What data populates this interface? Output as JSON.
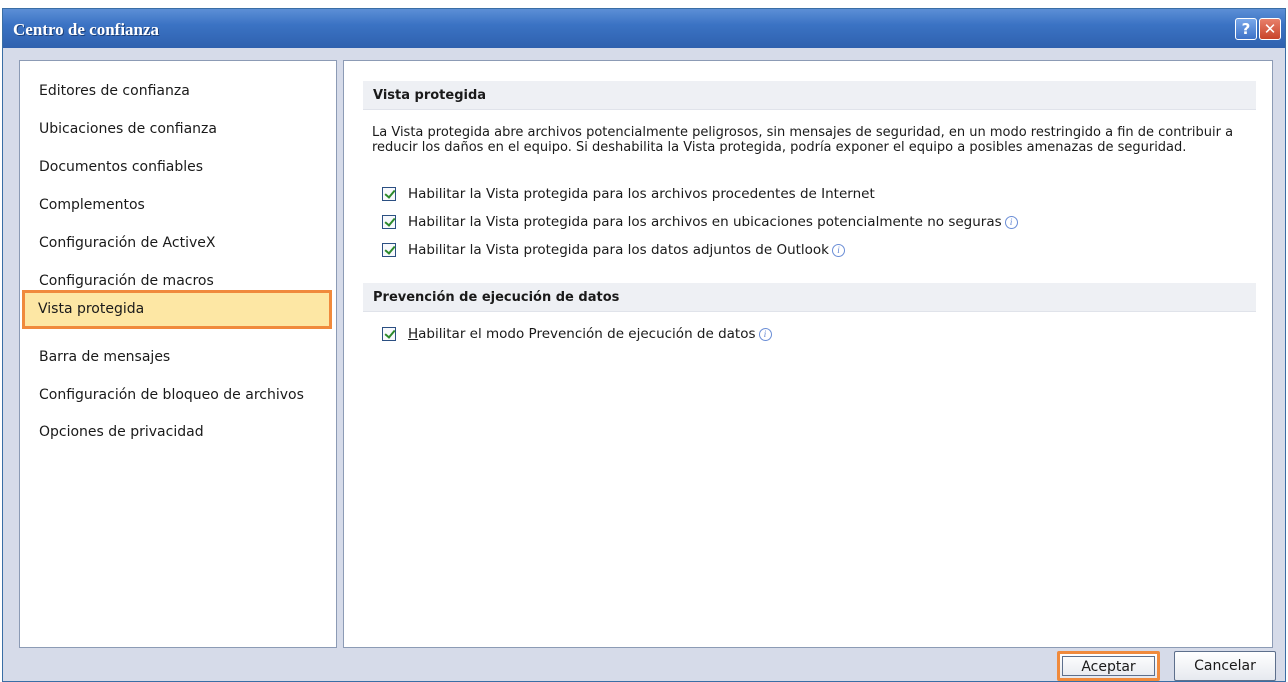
{
  "window": {
    "title": "Centro de confianza",
    "help_glyph": "?",
    "close_glyph": "✕"
  },
  "nav": {
    "items": [
      {
        "label": "Editores de confianza"
      },
      {
        "label": "Ubicaciones de confianza"
      },
      {
        "label": "Documentos confiables"
      },
      {
        "label": "Complementos"
      },
      {
        "label": "Configuración de ActiveX"
      },
      {
        "label": "Configuración de macros"
      },
      {
        "label": "Vista protegida",
        "selected": true
      },
      {
        "label": "Barra de mensajes"
      },
      {
        "label": "Configuración de bloqueo de archivos"
      },
      {
        "label": "Opciones de privacidad"
      }
    ]
  },
  "protected_view": {
    "header": "Vista protegida",
    "description": "La Vista protegida abre archivos potencialmente peligrosos, sin mensajes de seguridad, en un modo restringido a fin de contribuir a reducir los daños en el equipo. Si deshabilita la Vista protegida, podría exponer el equipo a posibles amenazas de seguridad.",
    "options": [
      {
        "label": "Habilitar la Vista protegida para los archivos procedentes de Internet",
        "checked": true
      },
      {
        "label": "Habilitar la Vista protegida para los archivos en ubicaciones potencialmente no seguras",
        "checked": true
      },
      {
        "label": "Habilitar la Vista protegida para los datos adjuntos de Outlook",
        "checked": true
      }
    ]
  },
  "dep": {
    "header": "Prevención de ejecución de datos",
    "option_accel": "H",
    "option_rest": "abilitar el modo Prevención de ejecución de datos",
    "checked": true
  },
  "buttons": {
    "ok": "Aceptar",
    "cancel": "Cancelar"
  },
  "icons": {
    "info": "i"
  },
  "colors": {
    "title_bar": "#3b73c4",
    "highlight_border": "#f08a3c",
    "selected_bg": "#fde7a4",
    "window_bg": "#d6dbe9"
  }
}
